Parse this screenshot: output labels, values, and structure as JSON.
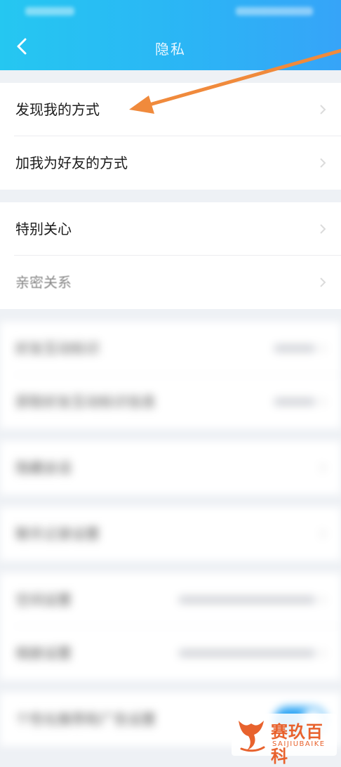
{
  "header": {
    "title": "隐私",
    "back_icon": "chevron-left-icon",
    "background_colors": [
      "#25c7f1",
      "#36a4f8"
    ]
  },
  "sections": [
    {
      "items": [
        {
          "label": "发现我的方式",
          "icon": "chevron-right-icon"
        },
        {
          "label": "加我为好友的方式",
          "icon": "chevron-right-icon"
        }
      ]
    },
    {
      "items": [
        {
          "label": "特别关心",
          "icon": "chevron-right-icon"
        },
        {
          "label": "亲密关系",
          "icon": "chevron-right-icon"
        }
      ]
    },
    {
      "items": [
        {
          "label": "好友互动标识",
          "icon": "chevron-right-icon"
        },
        {
          "label": "获取好友互动标识信息",
          "icon": "chevron-right-icon"
        }
      ]
    },
    {
      "items": [
        {
          "label": "隐藏会话",
          "icon": "chevron-right-icon"
        }
      ]
    },
    {
      "items": [
        {
          "label": "聊天记录设置",
          "icon": "chevron-right-icon"
        }
      ]
    },
    {
      "items": [
        {
          "label": "空间设置",
          "icon": "chevron-right-icon"
        },
        {
          "label": "相册设置",
          "icon": "chevron-right-icon"
        }
      ]
    },
    {
      "items": [
        {
          "label": "个性化推荐和广告设置",
          "toggle": true
        }
      ]
    }
  ],
  "annotation": {
    "color": "#f08a3c"
  },
  "watermark": {
    "cn": "赛玖百科",
    "en": "SAIJIUBAIKE",
    "color": "#e8622d"
  }
}
